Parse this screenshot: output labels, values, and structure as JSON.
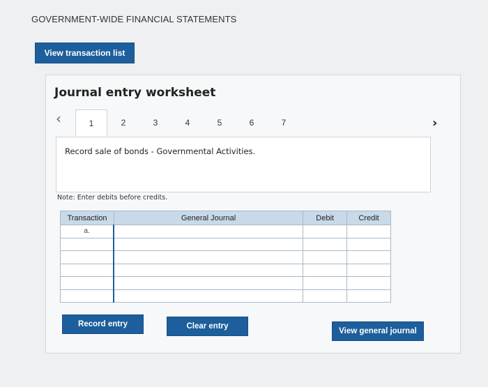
{
  "page": {
    "heading": "GOVERNMENT-WIDE FINANCIAL STATEMENTS"
  },
  "toolbar": {
    "view_transaction_list": "View transaction list"
  },
  "worksheet": {
    "title": "Journal entry worksheet",
    "prev_icon": "chevron-left-icon",
    "next_icon": "chevron-right-icon",
    "tabs": [
      "1",
      "2",
      "3",
      "4",
      "5",
      "6",
      "7"
    ],
    "active_tab": "1",
    "description": "Record sale of bonds - Governmental Activities.",
    "note": "Note: Enter debits before credits."
  },
  "journal": {
    "headers": {
      "transaction": "Transaction",
      "general_journal": "General Journal",
      "debit": "Debit",
      "credit": "Credit"
    },
    "rows": [
      {
        "transaction": "a.",
        "account": "",
        "debit": "",
        "credit": ""
      },
      {
        "transaction": "",
        "account": "",
        "debit": "",
        "credit": ""
      },
      {
        "transaction": "",
        "account": "",
        "debit": "",
        "credit": ""
      },
      {
        "transaction": "",
        "account": "",
        "debit": "",
        "credit": ""
      },
      {
        "transaction": "",
        "account": "",
        "debit": "",
        "credit": ""
      },
      {
        "transaction": "",
        "account": "",
        "debit": "",
        "credit": ""
      }
    ]
  },
  "actions": {
    "record_entry": "Record entry",
    "clear_entry": "Clear entry",
    "view_general_journal": "View general journal"
  },
  "colors": {
    "accent": "#1d5e9c",
    "table_header": "#c8d9ea"
  }
}
